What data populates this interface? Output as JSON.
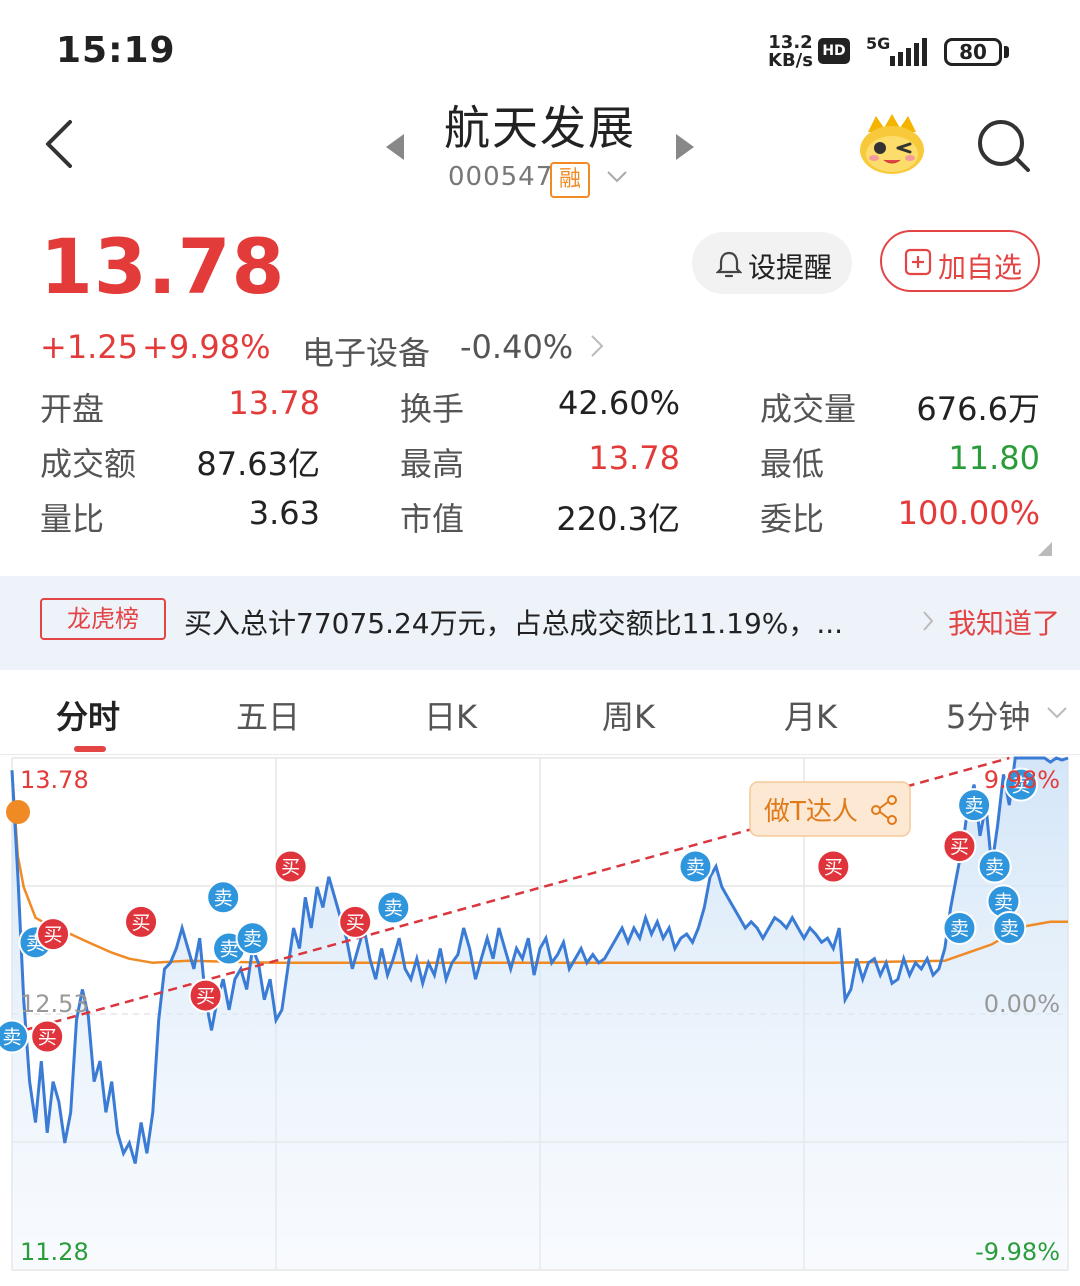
{
  "status_bar": {
    "time": "15:19",
    "net_speed_value": "13.2",
    "net_speed_unit": "KB/s",
    "hd": "HD",
    "network": "5G",
    "battery": "80"
  },
  "header": {
    "stock_name": "航天发展",
    "stock_code": "000547",
    "margin_tag": "融"
  },
  "quote": {
    "price": "13.78",
    "change": "+1.25",
    "change_pct": "+9.98%",
    "sector": "电子设备",
    "sector_change": "-0.40%",
    "alert_button": "设提醒",
    "watchlist_button": "加自选"
  },
  "stats": [
    [
      {
        "label": "开盘",
        "value": "13.78",
        "color": "red"
      },
      {
        "label": "换手",
        "value": "42.60%",
        "color": "dark"
      },
      {
        "label": "成交量",
        "value": "676.6万",
        "color": "dark"
      }
    ],
    [
      {
        "label": "成交额",
        "value": "87.63亿",
        "color": "dark"
      },
      {
        "label": "最高",
        "value": "13.78",
        "color": "red"
      },
      {
        "label": "最低",
        "value": "11.80",
        "color": "green"
      }
    ],
    [
      {
        "label": "量比",
        "value": "3.63",
        "color": "dark"
      },
      {
        "label": "市值",
        "value": "220.3亿",
        "color": "dark"
      },
      {
        "label": "委比",
        "value": "100.00%",
        "color": "red"
      }
    ]
  ],
  "dragon_tiger": {
    "tag": "龙虎榜",
    "text": "买入总计77075.24万元，占总成交额比11.19%，...",
    "ack": "我知道了"
  },
  "tabs": [
    "分时",
    "五日",
    "日K",
    "周K",
    "月K",
    "5分钟"
  ],
  "chart_data": {
    "type": "line",
    "ylim": [
      11.28,
      13.78
    ],
    "prev_close": 12.53,
    "tick_labels": {
      "top_price": "13.78",
      "mid_price": "12.53",
      "bottom_price": "11.28",
      "top_pct": "9.98%",
      "mid_pct": "0.00%",
      "bottom_pct": "-9.98%"
    },
    "badge": "做T达人",
    "buy_label": "买",
    "sell_label": "卖",
    "price_series": [
      [
        0,
        13.72
      ],
      [
        2,
        13.2
      ],
      [
        4,
        12.6
      ],
      [
        6,
        12.2
      ],
      [
        8,
        12.0
      ],
      [
        10,
        12.3
      ],
      [
        12,
        11.95
      ],
      [
        14,
        12.2
      ],
      [
        16,
        12.1
      ],
      [
        18,
        11.9
      ],
      [
        20,
        12.05
      ],
      [
        22,
        12.5
      ],
      [
        24,
        12.65
      ],
      [
        26,
        12.52
      ],
      [
        28,
        12.2
      ],
      [
        30,
        12.3
      ],
      [
        32,
        12.05
      ],
      [
        34,
        12.2
      ],
      [
        36,
        11.95
      ],
      [
        38,
        11.85
      ],
      [
        40,
        11.9
      ],
      [
        42,
        11.8
      ],
      [
        44,
        12.0
      ],
      [
        46,
        11.85
      ],
      [
        48,
        12.05
      ],
      [
        50,
        12.5
      ],
      [
        52,
        12.75
      ],
      [
        54,
        12.78
      ],
      [
        56,
        12.85
      ],
      [
        58,
        12.95
      ],
      [
        60,
        12.85
      ],
      [
        62,
        12.75
      ],
      [
        64,
        12.9
      ],
      [
        66,
        12.6
      ],
      [
        68,
        12.45
      ],
      [
        70,
        12.6
      ],
      [
        72,
        12.7
      ],
      [
        74,
        12.55
      ],
      [
        76,
        12.7
      ],
      [
        78,
        12.75
      ],
      [
        80,
        12.65
      ],
      [
        82,
        12.85
      ],
      [
        84,
        12.78
      ],
      [
        86,
        12.6
      ],
      [
        88,
        12.7
      ],
      [
        90,
        12.5
      ],
      [
        92,
        12.55
      ],
      [
        94,
        12.75
      ],
      [
        96,
        12.95
      ],
      [
        98,
        12.85
      ],
      [
        100,
        13.1
      ],
      [
        102,
        12.95
      ],
      [
        104,
        13.15
      ],
      [
        106,
        13.05
      ],
      [
        108,
        13.2
      ],
      [
        110,
        13.1
      ],
      [
        112,
        13.0
      ],
      [
        114,
        12.9
      ],
      [
        116,
        12.75
      ],
      [
        118,
        12.85
      ],
      [
        120,
        12.95
      ],
      [
        122,
        12.8
      ],
      [
        124,
        12.7
      ],
      [
        126,
        12.85
      ],
      [
        128,
        12.72
      ],
      [
        130,
        12.8
      ],
      [
        132,
        12.9
      ],
      [
        134,
        12.75
      ],
      [
        136,
        12.7
      ],
      [
        138,
        12.8
      ],
      [
        140,
        12.68
      ],
      [
        142,
        12.78
      ],
      [
        144,
        12.72
      ],
      [
        146,
        12.85
      ],
      [
        148,
        12.7
      ],
      [
        150,
        12.78
      ],
      [
        152,
        12.82
      ],
      [
        154,
        12.95
      ],
      [
        156,
        12.85
      ],
      [
        158,
        12.7
      ],
      [
        160,
        12.8
      ],
      [
        162,
        12.9
      ],
      [
        164,
        12.8
      ],
      [
        166,
        12.95
      ],
      [
        168,
        12.85
      ],
      [
        170,
        12.75
      ],
      [
        172,
        12.85
      ],
      [
        174,
        12.8
      ],
      [
        176,
        12.9
      ],
      [
        178,
        12.72
      ],
      [
        180,
        12.85
      ],
      [
        182,
        12.9
      ],
      [
        184,
        12.78
      ],
      [
        186,
        12.82
      ],
      [
        188,
        12.88
      ],
      [
        190,
        12.75
      ],
      [
        192,
        12.8
      ],
      [
        194,
        12.85
      ],
      [
        196,
        12.78
      ],
      [
        198,
        12.82
      ],
      [
        200,
        12.78
      ],
      [
        202,
        12.8
      ],
      [
        204,
        12.85
      ],
      [
        206,
        12.9
      ],
      [
        208,
        12.95
      ],
      [
        210,
        12.88
      ],
      [
        212,
        12.95
      ],
      [
        214,
        12.9
      ],
      [
        216,
        13.0
      ],
      [
        218,
        12.92
      ],
      [
        220,
        12.98
      ],
      [
        222,
        12.9
      ],
      [
        224,
        12.95
      ],
      [
        226,
        12.85
      ],
      [
        228,
        12.9
      ],
      [
        230,
        12.92
      ],
      [
        232,
        12.88
      ],
      [
        234,
        12.95
      ],
      [
        236,
        13.05
      ],
      [
        238,
        13.2
      ],
      [
        240,
        13.25
      ],
      [
        242,
        13.15
      ],
      [
        244,
        13.1
      ],
      [
        246,
        13.05
      ],
      [
        248,
        13.0
      ],
      [
        250,
        12.95
      ],
      [
        252,
        12.98
      ],
      [
        254,
        12.95
      ],
      [
        256,
        12.9
      ],
      [
        258,
        12.95
      ],
      [
        260,
        13.0
      ],
      [
        262,
        12.98
      ],
      [
        264,
        12.95
      ],
      [
        266,
        13.0
      ],
      [
        268,
        12.95
      ],
      [
        270,
        12.9
      ],
      [
        272,
        12.95
      ],
      [
        274,
        12.92
      ],
      [
        276,
        12.88
      ],
      [
        278,
        12.9
      ],
      [
        280,
        12.85
      ],
      [
        282,
        12.95
      ],
      [
        284,
        12.6
      ],
      [
        286,
        12.65
      ],
      [
        288,
        12.8
      ],
      [
        290,
        12.7
      ],
      [
        292,
        12.78
      ],
      [
        294,
        12.8
      ],
      [
        296,
        12.72
      ],
      [
        298,
        12.78
      ],
      [
        300,
        12.68
      ],
      [
        302,
        12.7
      ],
      [
        304,
        12.8
      ],
      [
        306,
        12.72
      ],
      [
        308,
        12.78
      ],
      [
        310,
        12.75
      ],
      [
        312,
        12.8
      ],
      [
        314,
        12.72
      ],
      [
        316,
        12.75
      ],
      [
        318,
        12.85
      ],
      [
        320,
        13.05
      ],
      [
        322,
        13.2
      ],
      [
        324,
        13.35
      ],
      [
        326,
        13.55
      ],
      [
        328,
        13.65
      ],
      [
        330,
        13.4
      ],
      [
        332,
        13.55
      ],
      [
        334,
        13.25
      ],
      [
        336,
        13.45
      ],
      [
        338,
        13.7
      ],
      [
        340,
        13.55
      ],
      [
        342,
        13.78
      ],
      [
        344,
        13.78
      ],
      [
        346,
        13.78
      ],
      [
        348,
        13.78
      ],
      [
        350,
        13.78
      ],
      [
        352,
        13.78
      ],
      [
        354,
        13.76
      ],
      [
        356,
        13.78
      ],
      [
        358,
        13.77
      ],
      [
        360,
        13.78
      ]
    ],
    "avg_series": [
      [
        0,
        13.72
      ],
      [
        2,
        13.3
      ],
      [
        4,
        13.15
      ],
      [
        8,
        13.0
      ],
      [
        14,
        12.95
      ],
      [
        20,
        12.92
      ],
      [
        26,
        12.88
      ],
      [
        34,
        12.83
      ],
      [
        40,
        12.8
      ],
      [
        48,
        12.78
      ],
      [
        60,
        12.79
      ],
      [
        90,
        12.78
      ],
      [
        200,
        12.78
      ],
      [
        280,
        12.78
      ],
      [
        318,
        12.79
      ],
      [
        326,
        12.83
      ],
      [
        334,
        12.87
      ],
      [
        340,
        12.92
      ],
      [
        346,
        12.96
      ],
      [
        354,
        12.98
      ],
      [
        360,
        12.98
      ]
    ],
    "trend_line": [
      [
        4,
        12.45
      ],
      [
        340,
        13.78
      ]
    ],
    "signals": [
      {
        "type": "sell",
        "t": 8,
        "p": 12.88
      },
      {
        "type": "buy",
        "t": 14,
        "p": 12.92
      },
      {
        "type": "buy",
        "t": 44,
        "p": 12.98
      },
      {
        "type": "buy",
        "t": 66,
        "p": 12.62
      },
      {
        "type": "sell",
        "t": 72,
        "p": 13.1
      },
      {
        "type": "sell",
        "t": 74,
        "p": 12.85
      },
      {
        "type": "sell",
        "t": 82,
        "p": 12.9
      },
      {
        "type": "buy",
        "t": 95,
        "p": 13.25
      },
      {
        "type": "buy",
        "t": 117,
        "p": 12.98
      },
      {
        "type": "sell",
        "t": 130,
        "p": 13.05
      },
      {
        "type": "sell",
        "t": 233,
        "p": 13.25
      },
      {
        "type": "buy",
        "t": 280,
        "p": 13.25
      },
      {
        "type": "buy",
        "t": 323,
        "p": 13.35
      },
      {
        "type": "sell",
        "t": 323,
        "p": 12.95
      },
      {
        "type": "sell",
        "t": 328,
        "p": 13.55
      },
      {
        "type": "sell",
        "t": 335,
        "p": 13.25
      },
      {
        "type": "sell",
        "t": 338,
        "p": 13.08
      },
      {
        "type": "sell",
        "t": 344,
        "p": 13.65
      },
      {
        "type": "sell",
        "t": 340,
        "p": 12.95
      }
    ],
    "edge_signals": [
      {
        "type": "sell",
        "t": 0,
        "p": 12.42
      },
      {
        "type": "buy",
        "t": 12,
        "p": 12.42
      }
    ]
  }
}
